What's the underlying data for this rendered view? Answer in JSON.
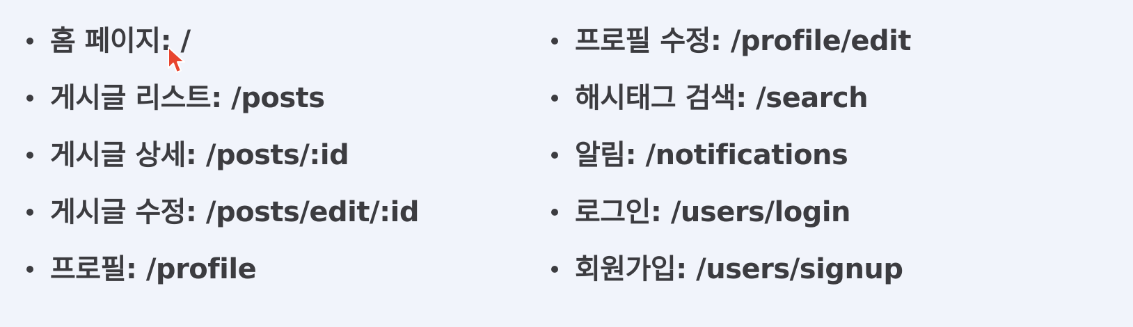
{
  "routes": {
    "left": [
      {
        "label": "홈 페이지: /"
      },
      {
        "label": "게시글 리스트: /posts"
      },
      {
        "label": "게시글 상세: /posts/:id"
      },
      {
        "label": "게시글 수정: /posts/edit/:id"
      },
      {
        "label": "프로필: /profile"
      }
    ],
    "right": [
      {
        "label": "프로필 수정: /profile/edit"
      },
      {
        "label": "해시태그 검색: /search"
      },
      {
        "label": "알림: /notifications"
      },
      {
        "label": "로그인: /users/login"
      },
      {
        "label": "회원가입: /users/signup"
      }
    ]
  },
  "cursor": {
    "icon": "mouse-pointer-icon",
    "color": "#e8442e"
  }
}
